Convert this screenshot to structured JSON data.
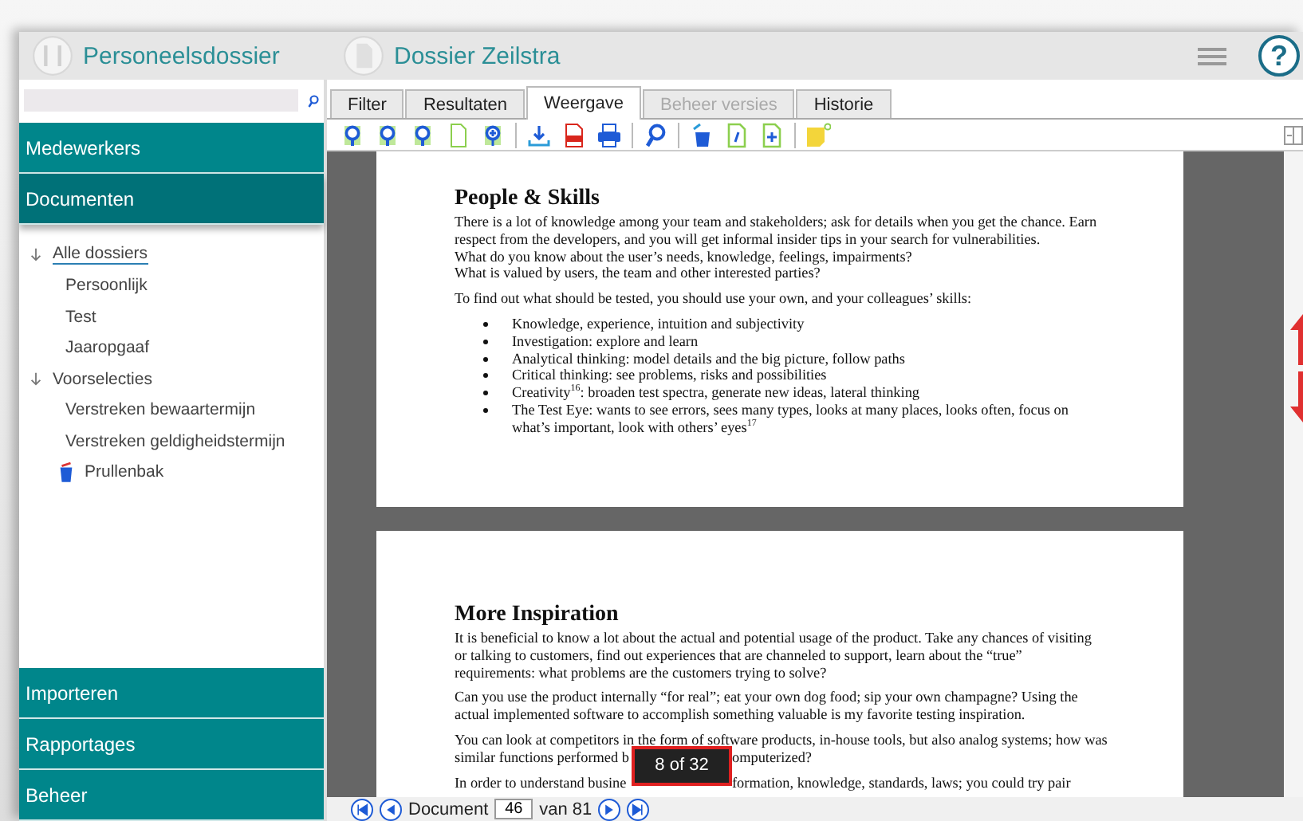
{
  "header": {
    "app_title": "Personeelsdossier",
    "dossier_title": "Dossier Zeilstra",
    "help": "?"
  },
  "nav_top": [
    {
      "label": "Medewerkers",
      "selected": false
    },
    {
      "label": "Documenten",
      "selected": true
    }
  ],
  "tree": [
    {
      "label": "Alle dossiers",
      "expanded": true,
      "selected": true,
      "children": [
        {
          "label": "Persoonlijk"
        },
        {
          "label": "Test"
        },
        {
          "label": "Jaaropgaaf"
        }
      ]
    },
    {
      "label": "Voorselecties",
      "expanded": true,
      "selected": false,
      "children": [
        {
          "label": "Verstreken bewaartermijn"
        },
        {
          "label": "Verstreken geldigheidstermijn"
        }
      ]
    },
    {
      "label": "Prullenbak",
      "kind": "trash"
    }
  ],
  "nav_bottom": [
    {
      "label": "Importeren",
      "selected": false
    },
    {
      "label": "Rapportages",
      "selected": false
    },
    {
      "label": "Beheer",
      "selected": false
    }
  ],
  "tabs": [
    {
      "label": "Filter",
      "selected": false,
      "disabled": false
    },
    {
      "label": "Resultaten",
      "selected": false,
      "disabled": false
    },
    {
      "label": "Weergave",
      "selected": true,
      "disabled": false
    },
    {
      "label": "Beheer versies",
      "selected": false,
      "disabled": true
    },
    {
      "label": "Historie",
      "selected": false,
      "disabled": false
    }
  ],
  "pages": [
    {
      "heading": "People & Skills",
      "blocks": [
        {
          "kind": "para",
          "lines": [
            "There is a lot of knowledge among your team and stakeholders; ask for details when you get the chance. Earn respect from the developers, and you will get informal insider tips in your search for vulnerabilities.",
            "What do you know about the user’s needs, knowledge, feelings, impairments?",
            "What is valued by users, the team and other interested parties?"
          ]
        },
        {
          "kind": "para",
          "lines": [
            "To find out what should be tested, you should use your own, and your colleagues’ skills:"
          ]
        },
        {
          "kind": "bullets",
          "items": [
            "Knowledge, experience, intuition and subjectivity",
            "Investigation: explore and learn",
            "Analytical thinking: model details and the big picture, follow paths",
            "Critical thinking: see problems, risks and possibilities",
            "Creativity$^{16}$: broaden test spectra, generate new ideas, lateral thinking",
            "The Test Eye: wants to see errors, sees many types, looks at many places, looks often, focus on what’s important, look with others’ eyes$^{17}$"
          ]
        }
      ]
    },
    {
      "heading": "More Inspiration",
      "blocks": [
        {
          "kind": "para",
          "lines": [
            "It is beneficial to know a lot about the actual and potential usage of the product. Take any chances of visiting or talking to customers, find out experiences that are channeled to support, learn about the “true” requirements: what problems are the customers trying to solve?"
          ]
        },
        {
          "kind": "para",
          "lines": [
            "Can you use the product internally “for real”; eat your own dog food; sip your own champagne? Using the actual implemented software to accomplish something valuable is my favorite testing inspiration."
          ]
        },
        {
          "kind": "para",
          "lines": [
            "You can look at competitors in the form of software products, in-house tools, but also analog systems; how was",
            {
              "left": "similar functions performed b",
              "right": "omputerized?"
            }
          ]
        },
        {
          "kind": "para",
          "lines": [
            {
              "left": "In order to understand busine",
              "right": "formation, knowledge, standards, laws; you could try pair"
            }
          ]
        }
      ]
    }
  ],
  "page_tooltip": "8 of 32",
  "footer": {
    "label": "Document",
    "value": "46",
    "total": "van 81"
  }
}
